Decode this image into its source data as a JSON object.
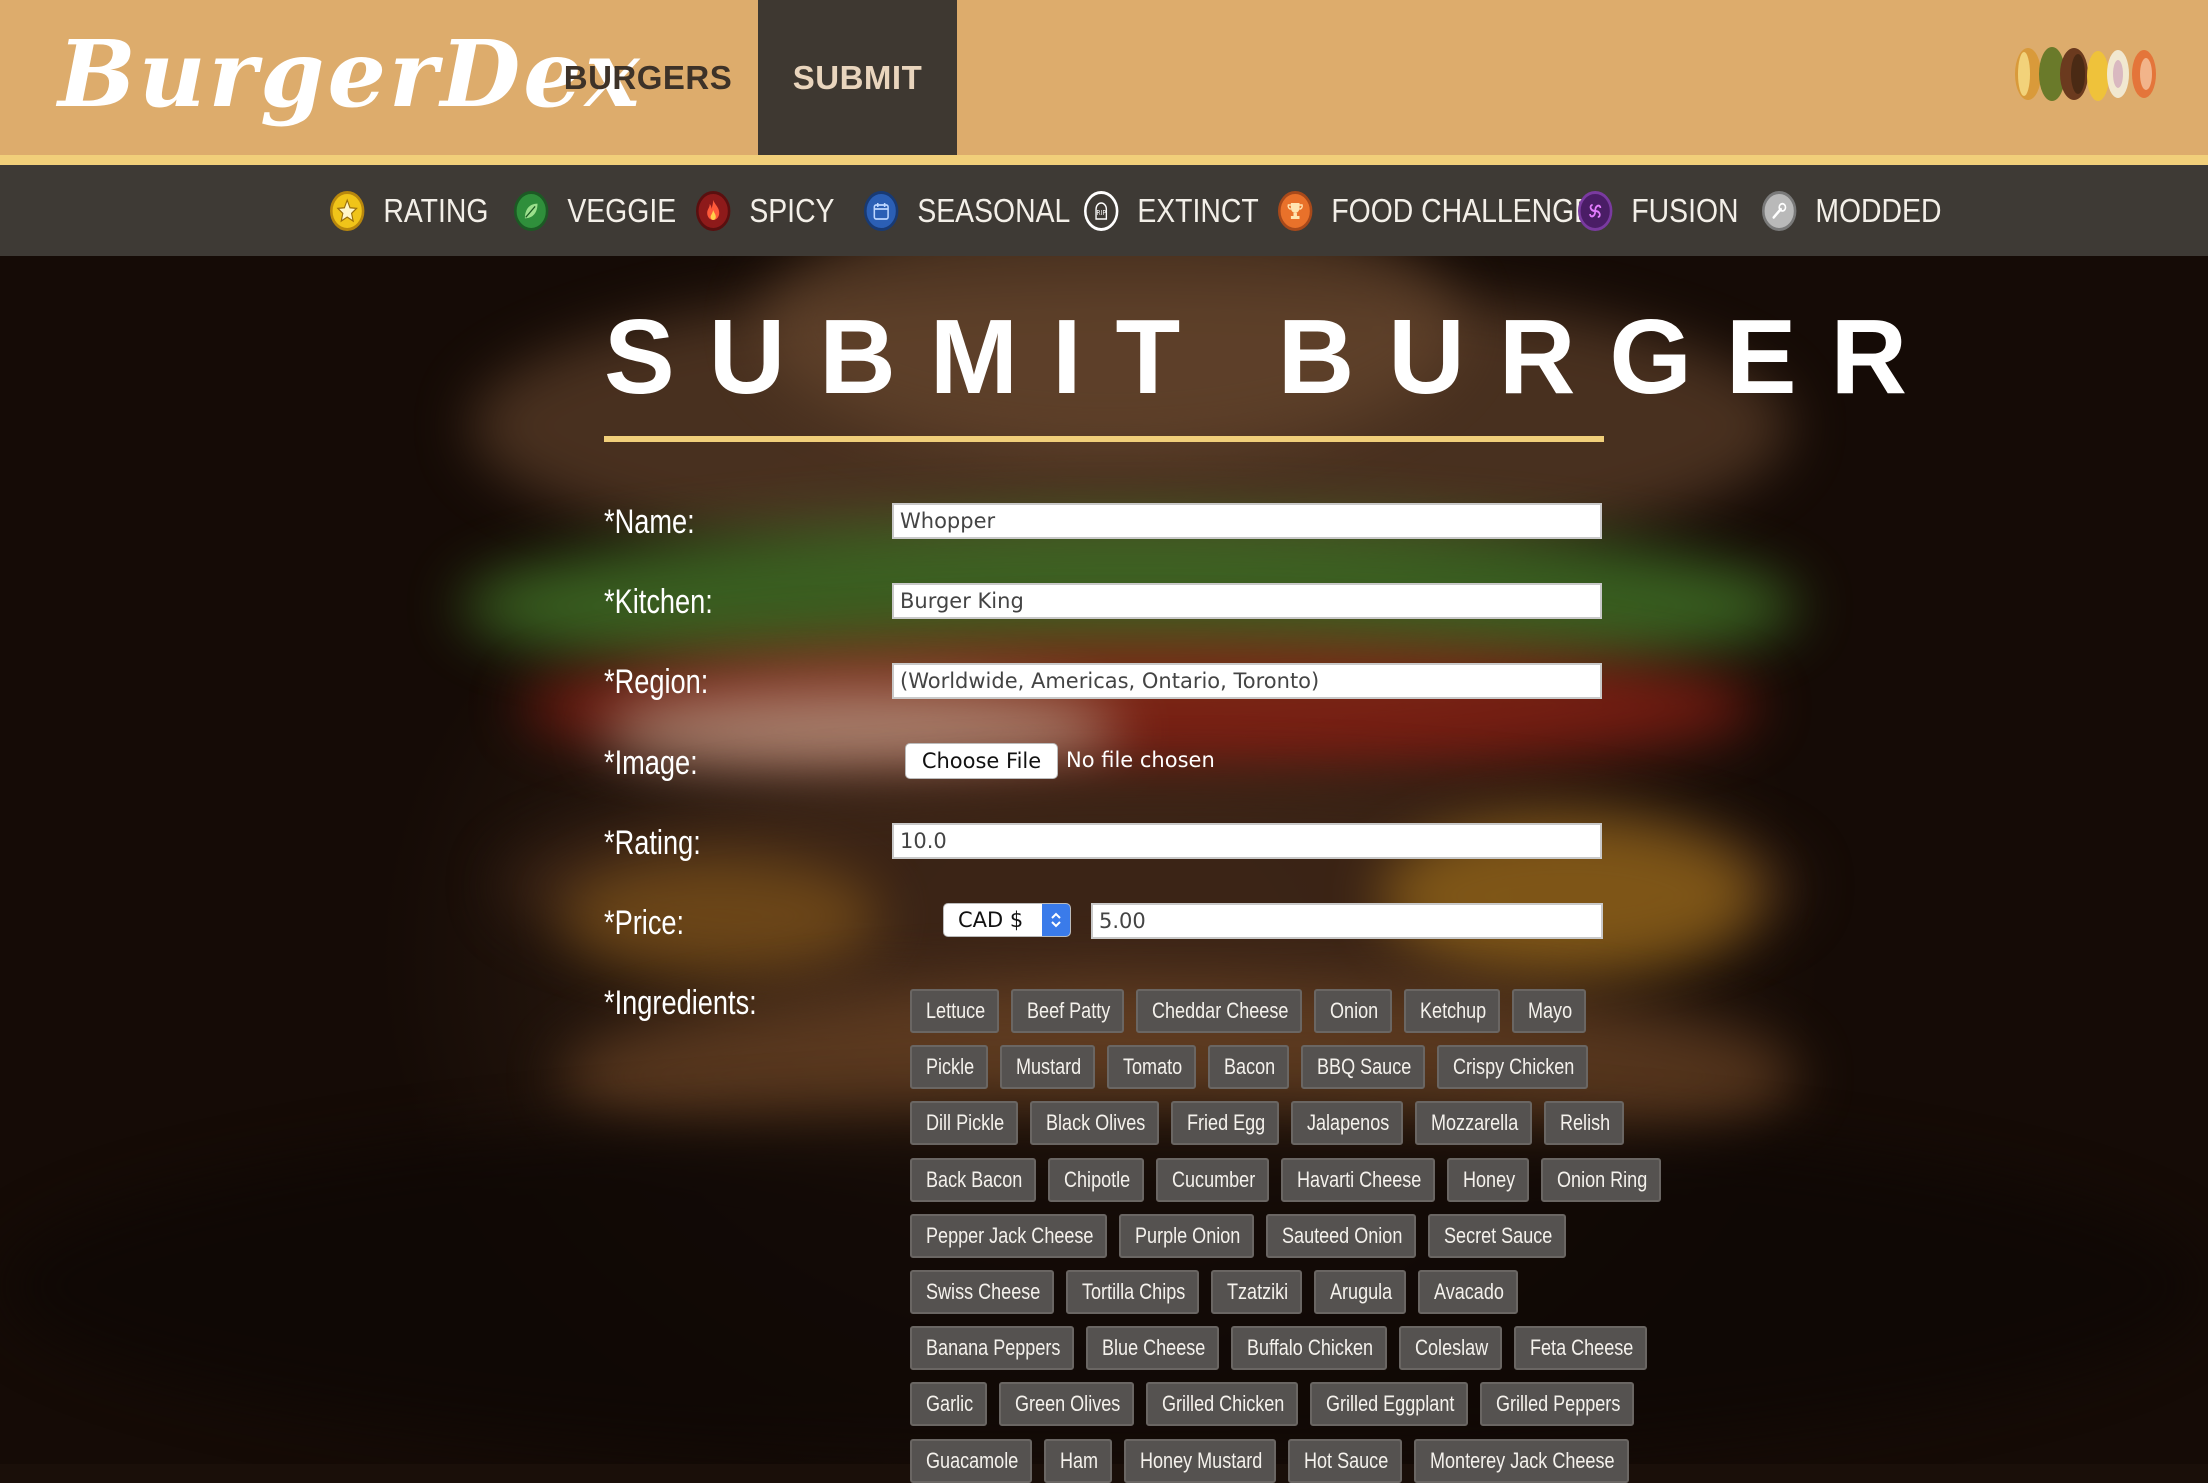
{
  "brand": {
    "logo_text": "BurgerDex"
  },
  "nav": {
    "burgers_label": "BURGERS",
    "submit_label": "SUBMIT",
    "active": "SUBMIT"
  },
  "categories": [
    {
      "label": "RATING",
      "icon": "star-icon",
      "color": "#f0c419"
    },
    {
      "label": "VEGGIE",
      "icon": "leaf-icon",
      "color": "#2f8f3b"
    },
    {
      "label": "SPICY",
      "icon": "flame-icon",
      "color": "#d12a2a"
    },
    {
      "label": "SEASONAL",
      "icon": "calendar-icon",
      "color": "#2b5fb5"
    },
    {
      "label": "EXTINCT",
      "icon": "rip-icon",
      "color": "#ffffff"
    },
    {
      "label": "FOOD CHALLENGE",
      "icon": "trophy-icon",
      "color": "#e9712a"
    },
    {
      "label": "FUSION",
      "icon": "fusion-icon",
      "color": "#6b2a8f"
    },
    {
      "label": "MODDED",
      "icon": "wrench-icon",
      "color": "#b9b9b9"
    }
  ],
  "form": {
    "title": "SUBMIT BURGER",
    "name_label": "*Name:",
    "name_placeholder": "Whopper",
    "kitchen_label": "*Kitchen:",
    "kitchen_placeholder": "Burger King",
    "region_label": "*Region:",
    "region_placeholder": "(Worldwide, Americas, Ontario, Toronto)",
    "image_label": "*Image:",
    "file_button": "Choose File",
    "file_status": "No file chosen",
    "rating_label": "*Rating:",
    "rating_placeholder": "10.0",
    "price_label": "*Price:",
    "currency_selected": "CAD $",
    "price_placeholder": "5.00",
    "ingredients_label": "*Ingredients:"
  },
  "ingredients": [
    [
      "Lettuce",
      "Beef Patty",
      "Cheddar Cheese",
      "Onion",
      "Ketchup",
      "Mayo"
    ],
    [
      "Pickle",
      "Mustard",
      "Tomato",
      "Bacon",
      "BBQ Sauce",
      "Crispy Chicken"
    ],
    [
      "Dill Pickle",
      "Black Olives",
      "Fried Egg",
      "Jalapenos",
      "Mozzarella",
      "Relish"
    ],
    [
      "Back Bacon",
      "Chipotle",
      "Cucumber",
      "Havarti Cheese",
      "Honey",
      "Onion Ring"
    ],
    [
      "Pepper Jack Cheese",
      "Purple Onion",
      "Sauteed Onion",
      "Secret Sauce"
    ],
    [
      "Swiss Cheese",
      "Tortilla Chips",
      "Tzatziki",
      "Arugula",
      "Avacado"
    ],
    [
      "Banana Peppers",
      "Blue Cheese",
      "Buffalo Chicken",
      "Coleslaw",
      "Feta Cheese"
    ],
    [
      "Garlic",
      "Green Olives",
      "Grilled Chicken",
      "Grilled Eggplant",
      "Grilled Peppers"
    ],
    [
      "Guacamole",
      "Ham",
      "Honey Mustard",
      "Hot Sauce",
      "Monterey Jack Cheese"
    ]
  ]
}
